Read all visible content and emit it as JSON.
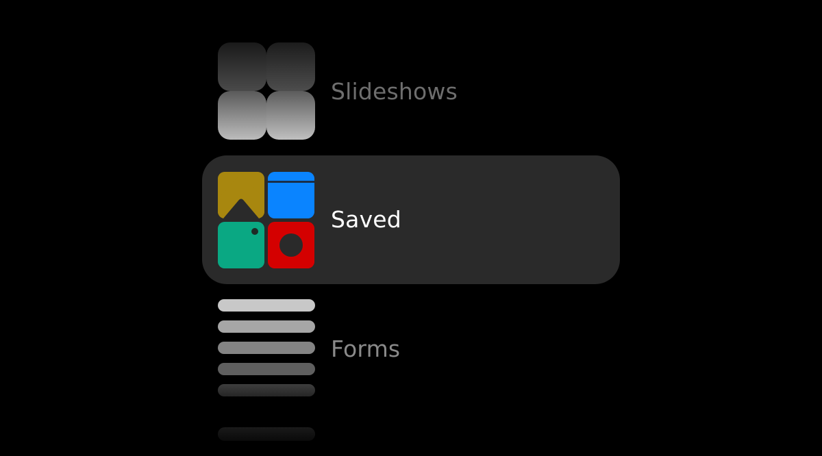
{
  "menu": {
    "items": [
      {
        "label": "Slideshows",
        "icon": "slideshows-grid-icon",
        "selected": false
      },
      {
        "label": "Saved",
        "icon": "saved-apps-icon",
        "selected": true
      },
      {
        "label": "Forms",
        "icon": "forms-lines-icon",
        "selected": false
      }
    ]
  },
  "colors": {
    "background": "#000000",
    "selected_row": "#2a2a2a",
    "photos_icon": "#a8870f",
    "browser_icon": "#0a84ff",
    "notes_icon": "#0aa883",
    "camera_icon": "#d40000",
    "label_selected": "#ffffff",
    "label_dim": "#6e6e6e"
  }
}
